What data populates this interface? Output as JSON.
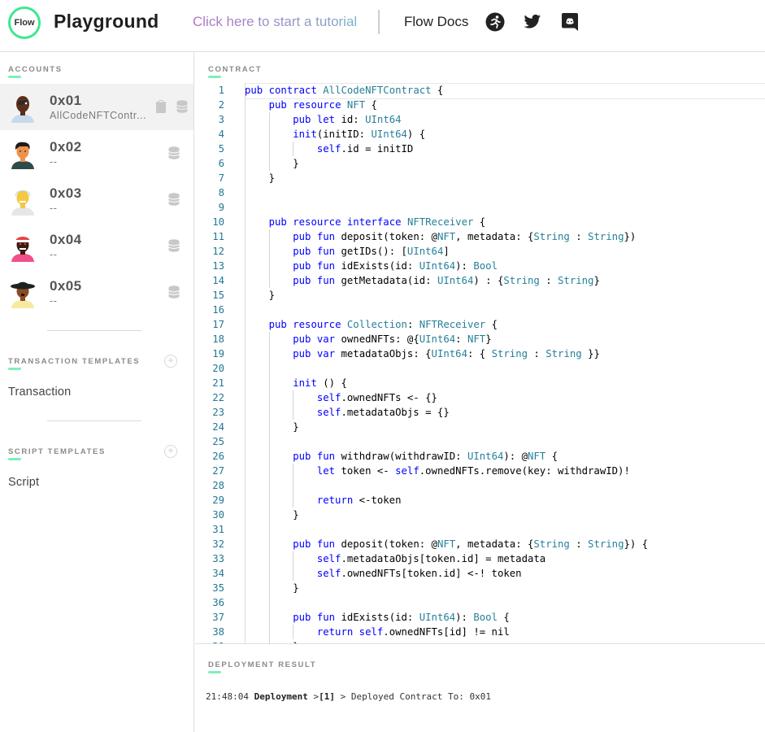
{
  "header": {
    "logo_text": "Flow",
    "title": "Playground",
    "tutorial_link": "Click here to start a tutorial",
    "docs_link": "Flow Docs",
    "social_icons": [
      "flow-runner-icon",
      "twitter-icon",
      "discord-icon"
    ]
  },
  "colors": {
    "accent_green": "#3ee88f",
    "underline_green": "#7df0b8",
    "tutorial_gradient_start": "#b075c4",
    "tutorial_gradient_end": "#6fb8c8",
    "keyword_blue": "#0000ff",
    "type_teal": "#267f99",
    "line_number": "#237893"
  },
  "sidebar": {
    "accounts_label": "ACCOUNTS",
    "accounts": [
      {
        "address": "0x01",
        "contract": "AllCodeNFTContr...",
        "active": true,
        "icons": [
          "clipboard-icon",
          "database-icon"
        ]
      },
      {
        "address": "0x02",
        "contract": "--",
        "active": false,
        "icons": [
          "database-icon"
        ]
      },
      {
        "address": "0x03",
        "contract": "--",
        "active": false,
        "icons": [
          "database-icon"
        ]
      },
      {
        "address": "0x04",
        "contract": "--",
        "active": false,
        "icons": [
          "database-icon"
        ]
      },
      {
        "address": "0x05",
        "contract": "--",
        "active": false,
        "icons": [
          "database-icon"
        ]
      }
    ],
    "transaction_templates_label": "TRANSACTION TEMPLATES",
    "transaction_templates": [
      "Transaction"
    ],
    "script_templates_label": "SCRIPT TEMPLATES",
    "script_templates": [
      "Script"
    ]
  },
  "editor": {
    "label": "CONTRACT",
    "current_line": 1,
    "lines": [
      "pub contract AllCodeNFTContract {",
      "    pub resource NFT {",
      "        pub let id: UInt64",
      "        init(initID: UInt64) {",
      "            self.id = initID",
      "        }",
      "    }",
      "",
      "",
      "    pub resource interface NFTReceiver {",
      "        pub fun deposit(token: @NFT, metadata: {String : String})",
      "        pub fun getIDs(): [UInt64]",
      "        pub fun idExists(id: UInt64): Bool",
      "        pub fun getMetadata(id: UInt64) : {String : String}",
      "    }",
      "",
      "    pub resource Collection: NFTReceiver {",
      "        pub var ownedNFTs: @{UInt64: NFT}",
      "        pub var metadataObjs: {UInt64: { String : String }}",
      "",
      "        init () {",
      "            self.ownedNFTs <- {}",
      "            self.metadataObjs = {}",
      "        }",
      "",
      "        pub fun withdraw(withdrawID: UInt64): @NFT {",
      "            let token <- self.ownedNFTs.remove(key: withdrawID)!",
      "",
      "            return <-token",
      "        }",
      "",
      "        pub fun deposit(token: @NFT, metadata: {String : String}) {",
      "            self.metadataObjs[token.id] = metadata",
      "            self.ownedNFTs[token.id] <-! token",
      "        }",
      "",
      "        pub fun idExists(id: UInt64): Bool {",
      "            return self.ownedNFTs[id] != nil",
      "        }"
    ]
  },
  "result": {
    "label": "DEPLOYMENT RESULT",
    "log": {
      "time": "21:48:04",
      "type": "Deployment",
      "sep1": " >",
      "index": "[1]",
      "sep2": " > ",
      "message": "Deployed Contract To: 0x01"
    }
  }
}
